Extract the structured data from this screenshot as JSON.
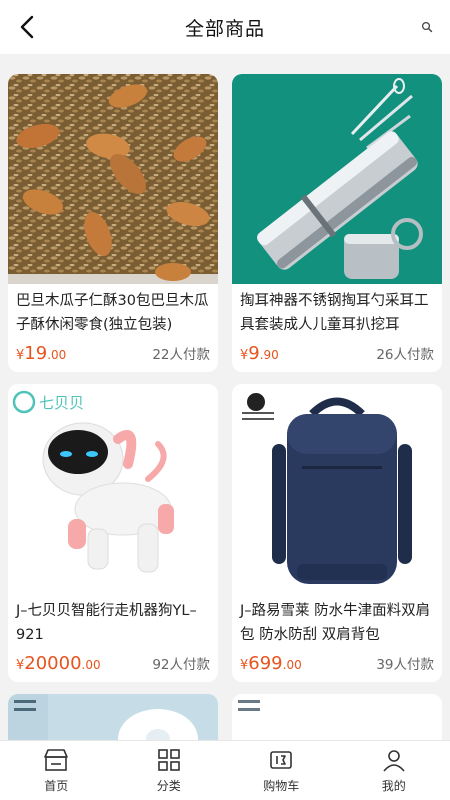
{
  "header": {
    "title": "全部商品",
    "back_icon": "back-arrow-icon",
    "search_icon": "search-icon"
  },
  "products": [
    {
      "name": "巴旦木瓜子仁酥30包巴旦木瓜子酥休闲零食(独立包装)",
      "currency": "¥",
      "price_int": "19",
      "price_dec": ".00",
      "sold": "22人付款"
    },
    {
      "name": "掏耳神器不锈钢掏耳勺采耳工具套装成人儿童耳扒挖耳",
      "currency": "¥",
      "price_int": "9",
      "price_dec": ".90",
      "sold": "26人付款"
    },
    {
      "name": "J–七贝贝智能行走机器狗YL–921",
      "currency": "¥",
      "price_int": "20000",
      "price_dec": ".00",
      "sold": "92人付款",
      "brand_logo": "七贝贝"
    },
    {
      "name": "J–路易雪莱 防水牛津面料双肩包 防水防刮 双肩背包",
      "currency": "¥",
      "price_int": "699",
      "price_dec": ".00",
      "sold": "39人付款"
    }
  ],
  "tabbar": [
    {
      "label": "首页",
      "icon": "store-icon"
    },
    {
      "label": "分类",
      "icon": "grid-icon"
    },
    {
      "label": "购物车",
      "icon": "cart-icon"
    },
    {
      "label": "我的",
      "icon": "user-icon"
    }
  ],
  "colors": {
    "price": "#e8541e",
    "accent_teal": "#139a86"
  }
}
